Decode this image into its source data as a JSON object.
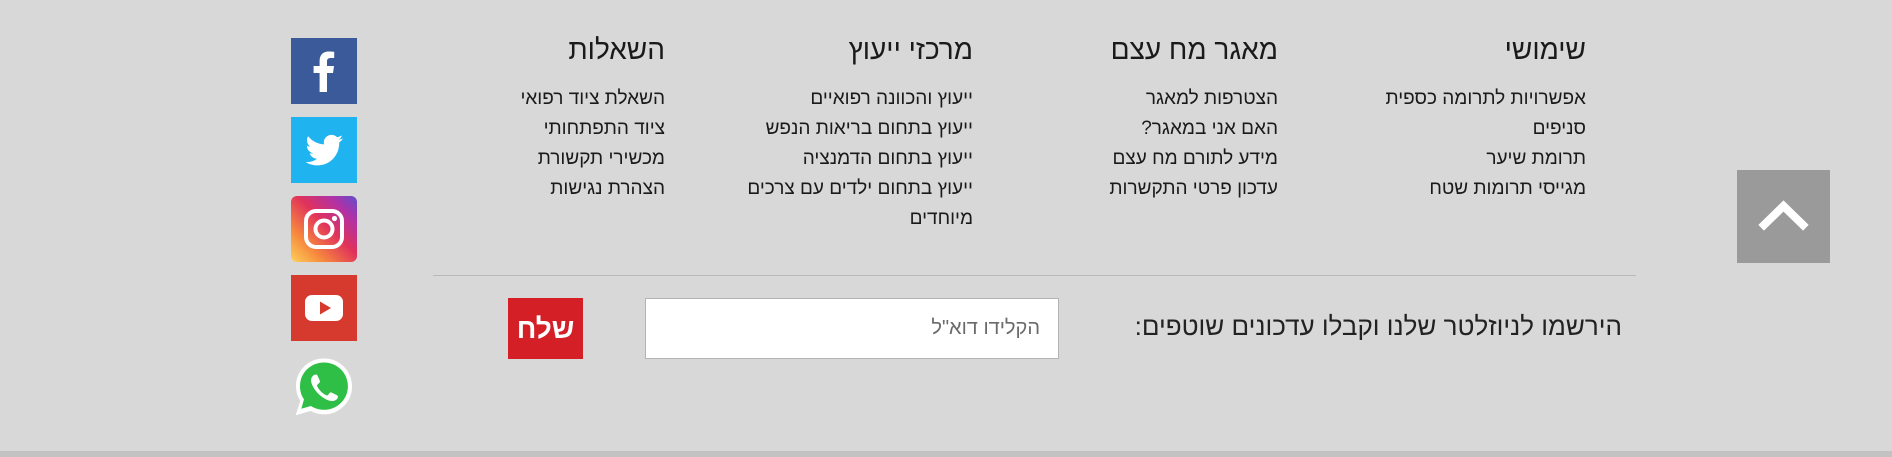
{
  "social": {
    "facebook": "facebook-icon",
    "twitter": "twitter-icon",
    "instagram": "instagram-icon",
    "youtube": "youtube-icon",
    "whatsapp": "whatsapp-icon"
  },
  "columns": [
    {
      "title": "שימושי",
      "items": [
        "אפשרויות לתרומה כספית",
        "סניפים",
        "תרומת שיער",
        "מגייסי תרומות שטח"
      ]
    },
    {
      "title": "מאגר מח עצם",
      "items": [
        "הצטרפות למאגר",
        "האם אני במאגר?",
        "מידע לתורם מח עצם",
        "עדכון פרטי התקשרות"
      ]
    },
    {
      "title": "מרכזי ייעוץ",
      "items": [
        "ייעוץ והכוונה רפואיים",
        "ייעוץ בתחום בריאות הנפש",
        "ייעוץ בתחום הדמנציה",
        "ייעוץ בתחום ילדים עם צרכים מיוחדים"
      ]
    },
    {
      "title": "השאלות",
      "items": [
        "השאלת ציוד רפואי",
        "ציוד התפתחותי",
        "מכשירי תקשורת",
        "הצהרת נגישות"
      ]
    }
  ],
  "newsletter": {
    "label": "הירשמו לניוזלטר שלנו וקבלו עדכונים שוטפים:",
    "placeholder": "הקלידו דוא\"ל",
    "send": "שלח"
  },
  "scroll_top": {
    "icon": "chevron-up-icon"
  },
  "colors": {
    "background": "#d8d8d8",
    "send_button": "#d41f27",
    "facebook": "#3b5a9a",
    "twitter": "#1fb3f0",
    "youtube": "#d63a2f",
    "whatsapp": "#25b33a"
  }
}
